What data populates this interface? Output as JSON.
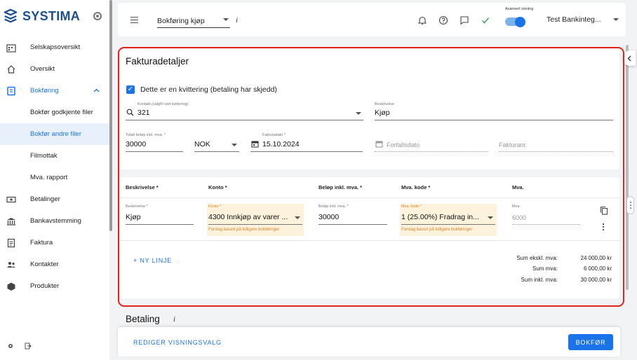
{
  "brand": {
    "name": "SYSTIMA",
    "color": "#1e4f8f"
  },
  "accent": "#1a73e8",
  "highlight_color": "#e0231b",
  "sidebar": {
    "items": [
      {
        "label": "Selskapsoversikt",
        "icon": "building-icon"
      },
      {
        "label": "Oversikt",
        "icon": "home-icon"
      },
      {
        "label": "Bokføring",
        "icon": "bookkeeping-icon",
        "active": true,
        "expanded": true
      },
      {
        "label": "Bokfør godkjente filer",
        "sub": true
      },
      {
        "label": "Bokfør andre filer",
        "sub": true,
        "selected": true
      },
      {
        "label": "Filmottak",
        "sub": true
      },
      {
        "label": "Mva. rapport",
        "sub": true
      },
      {
        "label": "Betalinger",
        "icon": "payments-icon"
      },
      {
        "label": "Bankavstemming",
        "icon": "bank-icon"
      },
      {
        "label": "Faktura",
        "icon": "invoice-icon"
      },
      {
        "label": "Kontakter",
        "icon": "contacts-icon"
      },
      {
        "label": "Produkter",
        "icon": "products-icon"
      }
    ]
  },
  "topbar": {
    "page_select": "Bokføring kjøp",
    "info": "i",
    "advanced_view_label": "Avansert visning",
    "advanced_view_on": true,
    "user": "Test Bankinteg..."
  },
  "invoice": {
    "title": "Fakturadetaljer",
    "receipt_checkbox_label": "Dette er en kvittering (betaling har skjedd)",
    "receipt_checked": true,
    "contact_label": "Kontakt (valgfri ved kvittering)",
    "contact_value": "321",
    "description_label": "Beskrivelse",
    "description_value": "Kjøp",
    "total_label": "Totalt beløp inkl. mva. *",
    "total_value": "30000",
    "currency": "NOK",
    "invoice_date_label": "Fakturadato *",
    "invoice_date_value": "15.10.2024",
    "due_date_placeholder": "Forfallsdato",
    "invoice_no_placeholder": "Fakturanr."
  },
  "lines": {
    "headers": [
      "Beskrivelse *",
      "Konto *",
      "Beløp inkl. mva. *",
      "Mva. kode *",
      "Mva."
    ],
    "row": {
      "description_label": "Beskrivelse *",
      "description": "Kjøp",
      "account_label": "Konto *",
      "account": "4300 Innkjøp av varer ...",
      "account_hint": "Forslag basert på tidligere bokføringer",
      "amount_label": "Beløp inkl. mva. *",
      "amount": "30000",
      "vat_code_label": "Mva. kode *",
      "vat_code": "1 (25.00%) Fradrag in...",
      "vat_code_hint": "Forslag basert på tidligere bokføringer",
      "vat_label": "Mva.",
      "vat_placeholder": "6000"
    },
    "add_line": "+ NY LINJE",
    "sums": [
      {
        "label": "Sum ekskl. mva:",
        "value": "24 000,00 kr"
      },
      {
        "label": "Sum mva:",
        "value": "6 000,00 kr"
      },
      {
        "label": "Sum inkl. mva:",
        "value": "30 000,00 kr"
      }
    ]
  },
  "payment": {
    "title": "Betaling",
    "info": "i"
  },
  "footer": {
    "edit_view": "REDIGER VISNINGSVALG",
    "post": "BOKFØR"
  }
}
